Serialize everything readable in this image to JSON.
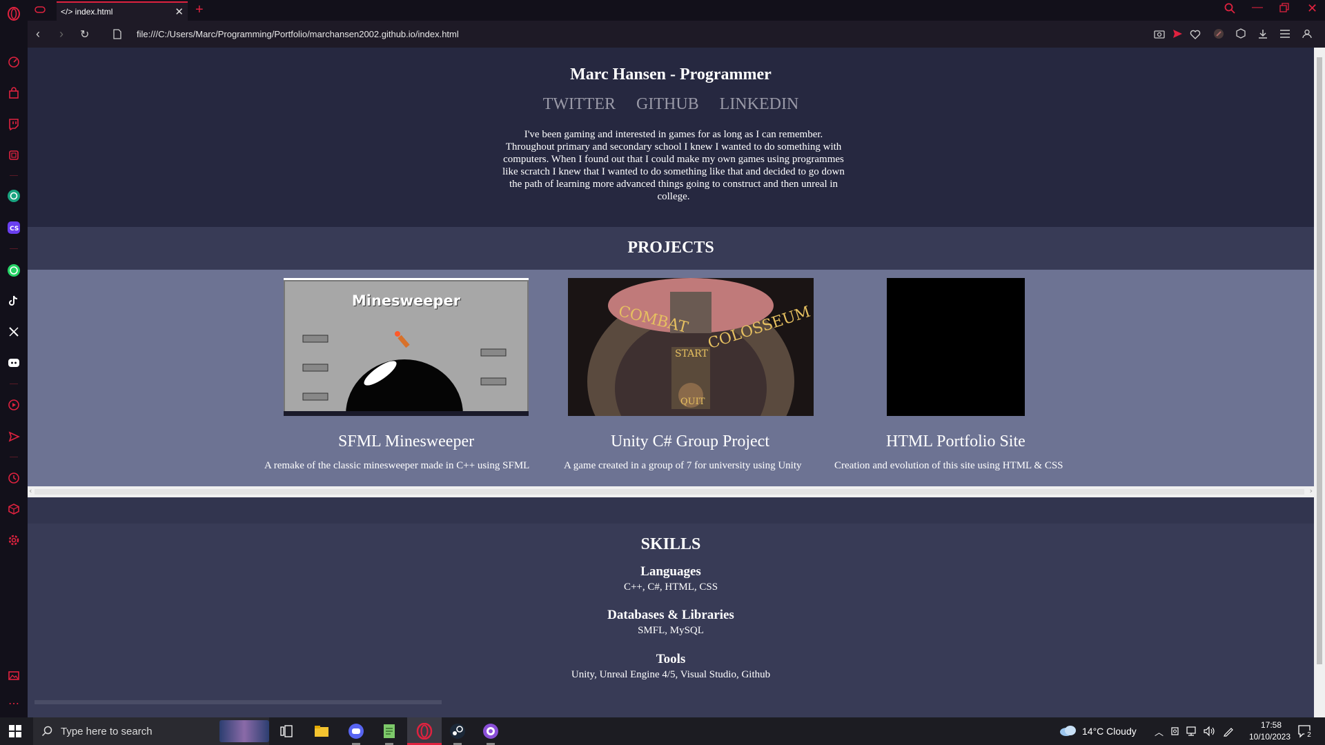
{
  "browser": {
    "tab_title": "</> index.html",
    "url": "file:///C:/Users/Marc/Programming/Portfolio/marchansen2002.github.io/index.html"
  },
  "page": {
    "header": {
      "title": "Marc Hansen - Programmer",
      "links": [
        "TWITTER",
        "GITHUB",
        "LINKEDIN"
      ],
      "bio": "I've been gaming and interested in games for as long as I can remember. Throughout primary and secondary school I knew I wanted to do something with computers. When I found out that I could make my own games using programmes like scratch I knew that I wanted to do something like that and decided to go down the path of learning more advanced things going to construct and then unreal in college."
    },
    "projects": {
      "heading": "PROJECTS",
      "items": [
        {
          "title": "SFML Minesweeper",
          "description": "A remake of the classic minesweeper made in C++ using SFML",
          "thumb_text": "Minesweeper"
        },
        {
          "title": "Unity C# Group Project",
          "description": "A game created in a group of 7 for university using Unity",
          "thumb_text_1": "COMBAT",
          "thumb_text_2": "COLOSSEUM",
          "thumb_start": "START",
          "thumb_quit": "QUIT"
        },
        {
          "title": "HTML Portfolio Site",
          "description": "Creation and evolution of this site using HTML & CSS"
        }
      ]
    },
    "skills": {
      "heading": "SKILLS",
      "groups": [
        {
          "heading": "Languages",
          "items": "C++, C#, HTML, CSS"
        },
        {
          "heading": "Databases & Libraries",
          "items": "SMFL, MySQL"
        },
        {
          "heading": "Tools",
          "items": "Unity, Unreal Engine 4/5, Visual Studio, Github"
        }
      ]
    }
  },
  "taskbar": {
    "search_placeholder": "Type here to search",
    "weather": "14°C  Cloudy",
    "time": "17:58",
    "date": "10/10/2023",
    "notification_count": "2"
  },
  "colors": {
    "accent": "#e0223f",
    "header_bg": "#262840",
    "projects_bg": "#6d7393",
    "page_bg": "#383b56"
  }
}
